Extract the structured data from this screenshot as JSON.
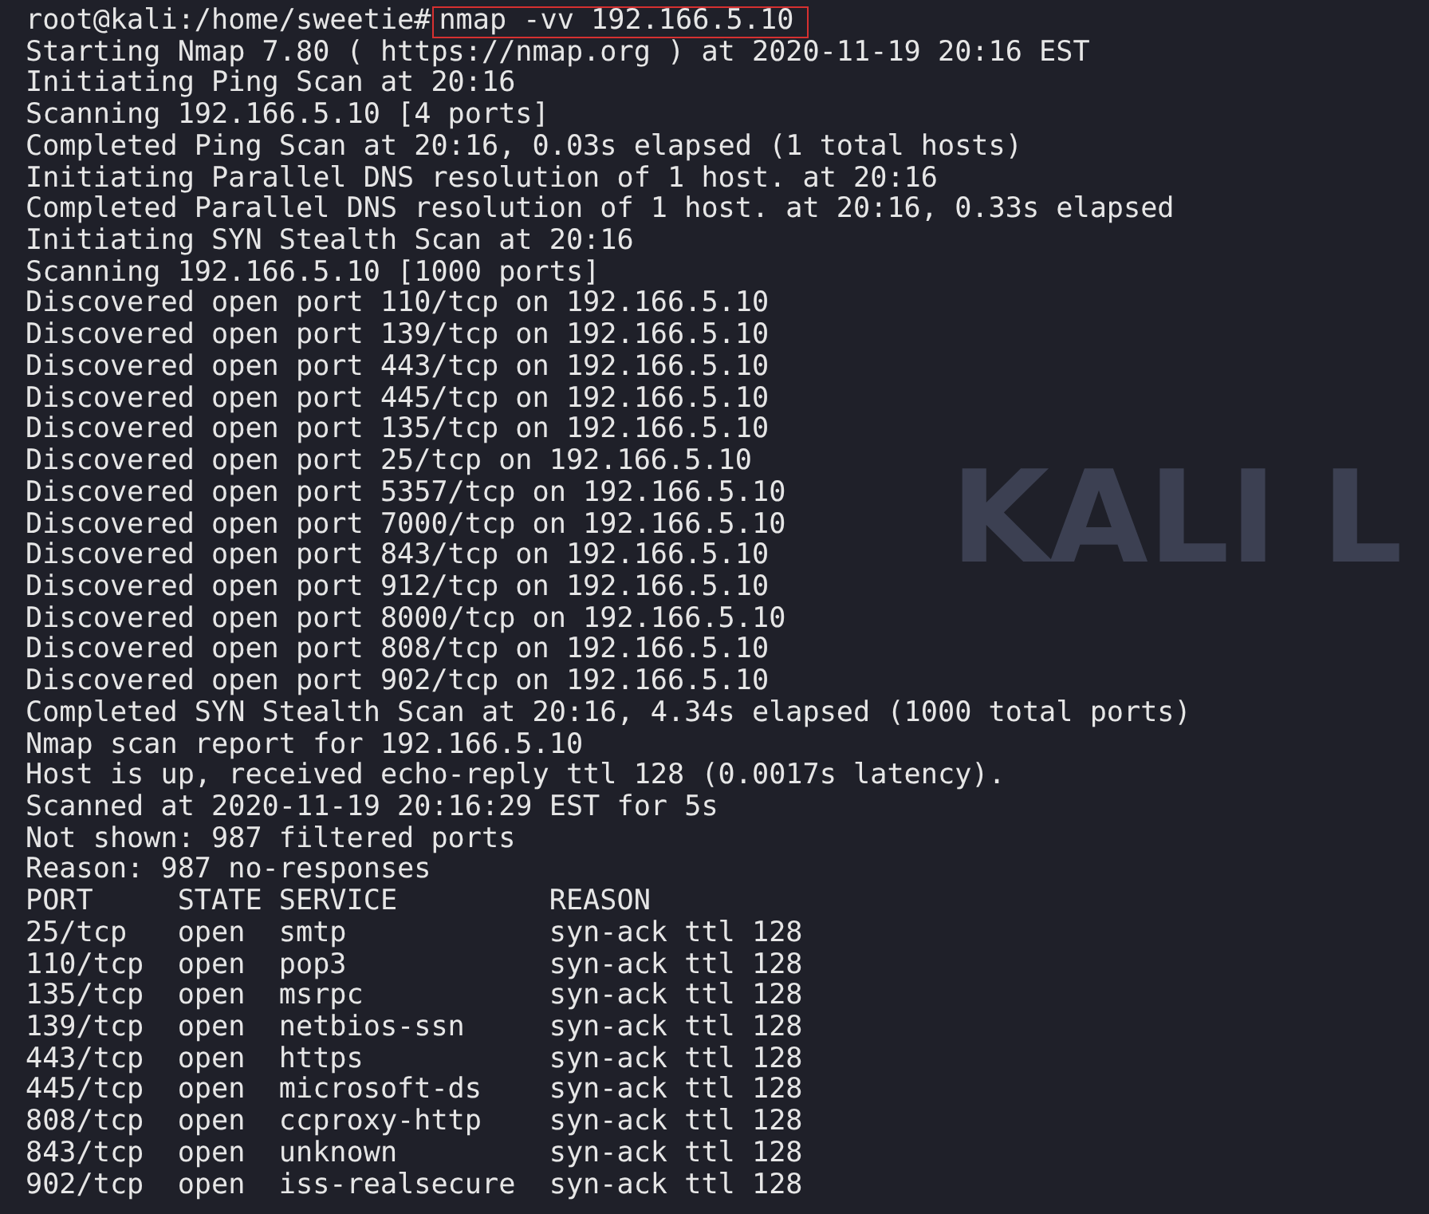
{
  "prompt": "root@kali:/home/sweetie#",
  "command": "nmap -vv 192.166.5.10",
  "wallpaper_text": "KALI L",
  "output": [
    "Starting Nmap 7.80 ( https://nmap.org ) at 2020-11-19 20:16 EST",
    "Initiating Ping Scan at 20:16",
    "Scanning 192.166.5.10 [4 ports]",
    "Completed Ping Scan at 20:16, 0.03s elapsed (1 total hosts)",
    "Initiating Parallel DNS resolution of 1 host. at 20:16",
    "Completed Parallel DNS resolution of 1 host. at 20:16, 0.33s elapsed",
    "Initiating SYN Stealth Scan at 20:16",
    "Scanning 192.166.5.10 [1000 ports]",
    "Discovered open port 110/tcp on 192.166.5.10",
    "Discovered open port 139/tcp on 192.166.5.10",
    "Discovered open port 443/tcp on 192.166.5.10",
    "Discovered open port 445/tcp on 192.166.5.10",
    "Discovered open port 135/tcp on 192.166.5.10",
    "Discovered open port 25/tcp on 192.166.5.10",
    "Discovered open port 5357/tcp on 192.166.5.10",
    "Discovered open port 7000/tcp on 192.166.5.10",
    "Discovered open port 843/tcp on 192.166.5.10",
    "Discovered open port 912/tcp on 192.166.5.10",
    "Discovered open port 8000/tcp on 192.166.5.10",
    "Discovered open port 808/tcp on 192.166.5.10",
    "Discovered open port 902/tcp on 192.166.5.10",
    "Completed SYN Stealth Scan at 20:16, 4.34s elapsed (1000 total ports)",
    "Nmap scan report for 192.166.5.10",
    "Host is up, received echo-reply ttl 128 (0.0017s latency).",
    "Scanned at 2020-11-19 20:16:29 EST for 5s",
    "Not shown: 987 filtered ports",
    "Reason: 987 no-responses",
    "PORT     STATE SERVICE         REASON",
    "25/tcp   open  smtp            syn-ack ttl 128",
    "110/tcp  open  pop3            syn-ack ttl 128",
    "135/tcp  open  msrpc           syn-ack ttl 128",
    "139/tcp  open  netbios-ssn     syn-ack ttl 128",
    "443/tcp  open  https           syn-ack ttl 128",
    "445/tcp  open  microsoft-ds    syn-ack ttl 128",
    "808/tcp  open  ccproxy-http    syn-ack ttl 128",
    "843/tcp  open  unknown         syn-ack ttl 128",
    "902/tcp  open  iss-realsecure  syn-ack ttl 128"
  ]
}
